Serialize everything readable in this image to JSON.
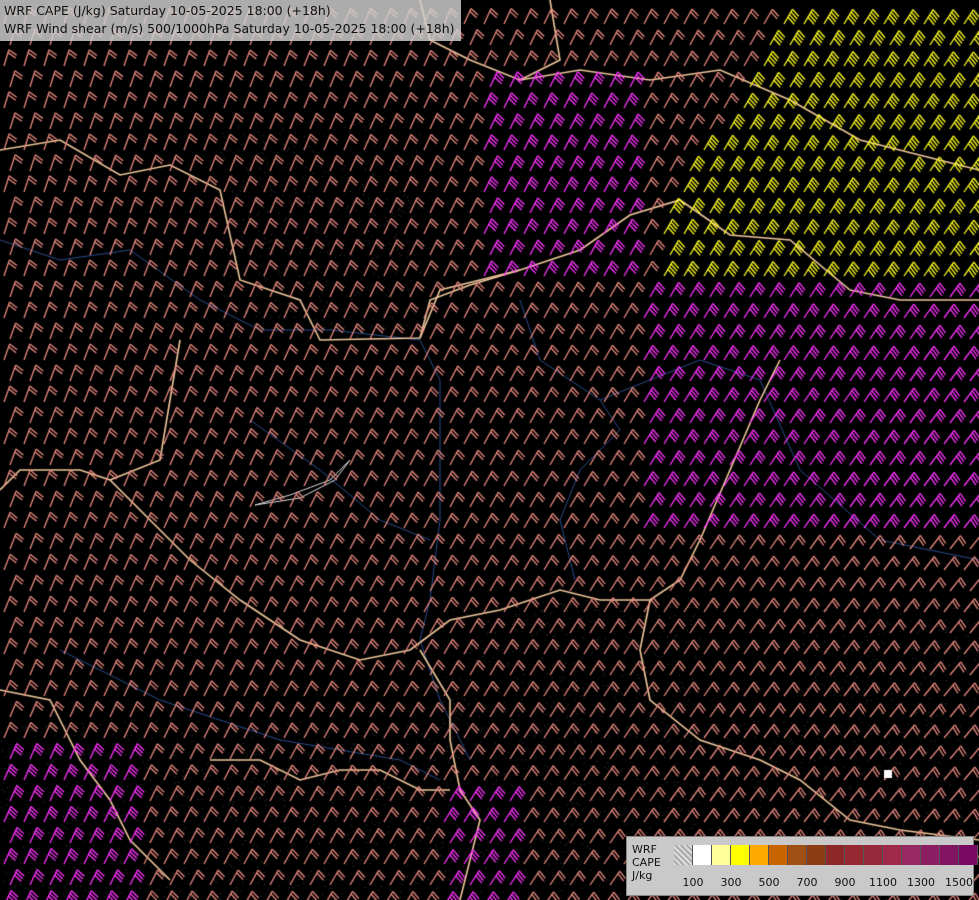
{
  "titles": {
    "line1": "WRF CAPE (J/kg) Saturday 10-05-2025 18:00 (+18h)",
    "line2": "WRF Wind shear (m/s) 500/1000hPa Saturday 10-05-2025 18:00 (+18h)"
  },
  "legend": {
    "label_lines": [
      "WRF",
      "CAPE",
      "J/kg"
    ],
    "colors": [
      "#ffffff",
      "#ffff99",
      "#ffff00",
      "#ffaa00",
      "#c86400",
      "#a05014",
      "#8c3c14",
      "#8c2828",
      "#962832",
      "#96283c",
      "#a0284b",
      "#962864",
      "#8c1e64",
      "#821464",
      "#780a64"
    ],
    "tick_labels": [
      "100",
      "300",
      "500",
      "700",
      "900",
      "1100",
      "1300",
      "1500"
    ]
  },
  "colors": {
    "barb_low": "#e88a80",
    "barb_mid": "#ff33ff",
    "barb_high": "#ffff22",
    "border": "#f0c89c",
    "river": "#2a4c8c",
    "background": "#000000"
  }
}
